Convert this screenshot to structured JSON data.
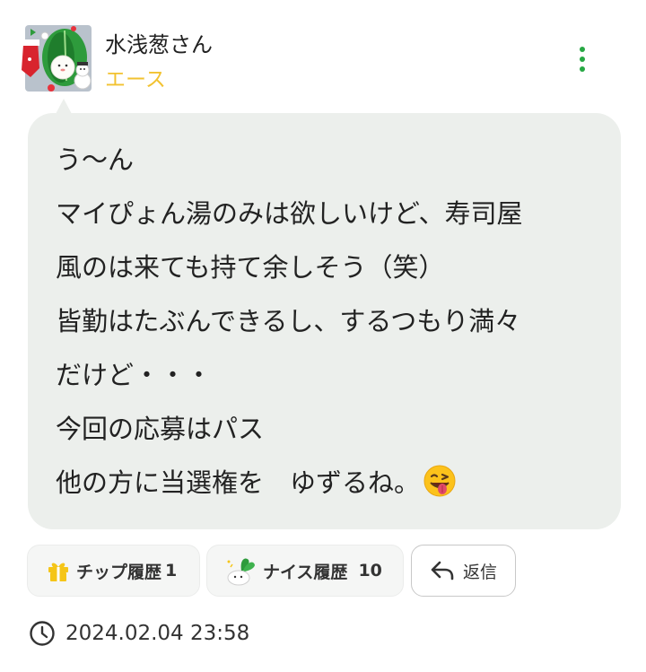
{
  "post": {
    "username": "水浅葱さん",
    "rank": "エース",
    "lines": [
      "う〜ん",
      "マイぴょん湯のみは欲しいけど、寿司屋",
      "風のは来ても持て余しそう（笑）",
      "皆勤はたぶんできるし、するつもり満々",
      "だけど・・・",
      "今回の応募はパス",
      "他の方に当選権を　ゆずるね。"
    ],
    "emoji": "winking-face-with-tongue-icon"
  },
  "actions": {
    "tip_label": "チップ履歴",
    "tip_count": "1",
    "nice_label": "ナイス履歴",
    "nice_count": "10",
    "reply_label": "返信"
  },
  "timestamp": "2024.02.04 23:58",
  "colors": {
    "accent": "#27a844",
    "rank": "#f2c230",
    "bubble": "#ecefec",
    "gift": "#f5c518"
  }
}
